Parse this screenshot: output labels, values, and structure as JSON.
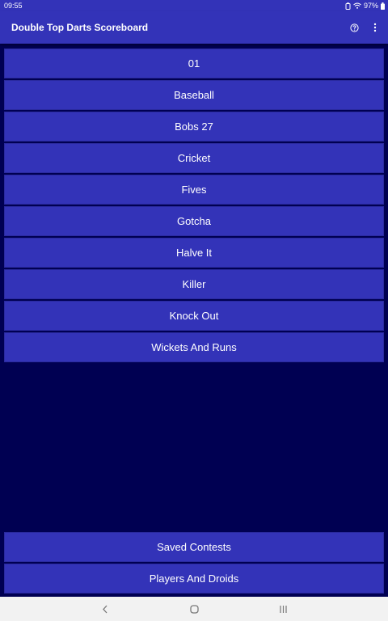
{
  "status_bar": {
    "time": "09:55",
    "battery": "97%"
  },
  "app_bar": {
    "title": "Double Top Darts Scoreboard",
    "help_icon": "help-circle-icon",
    "overflow_icon": "more-vert-icon"
  },
  "games": [
    {
      "label": "01"
    },
    {
      "label": "Baseball"
    },
    {
      "label": "Bobs 27"
    },
    {
      "label": "Cricket"
    },
    {
      "label": "Fives"
    },
    {
      "label": "Gotcha"
    },
    {
      "label": "Halve It"
    },
    {
      "label": "Killer"
    },
    {
      "label": "Knock Out"
    },
    {
      "label": "Wickets And Runs"
    }
  ],
  "bottom": {
    "saved_contests": "Saved Contests",
    "players_and_droids": "Players And Droids"
  },
  "nav": {
    "back_icon": "back-chevron-icon",
    "home_icon": "home-circle-icon",
    "recents_icon": "recents-bars-icon"
  },
  "colors": {
    "background": "#000052",
    "primary": "#3333b8",
    "text": "#ffffff",
    "nav_bar": "#f2f2f2"
  }
}
